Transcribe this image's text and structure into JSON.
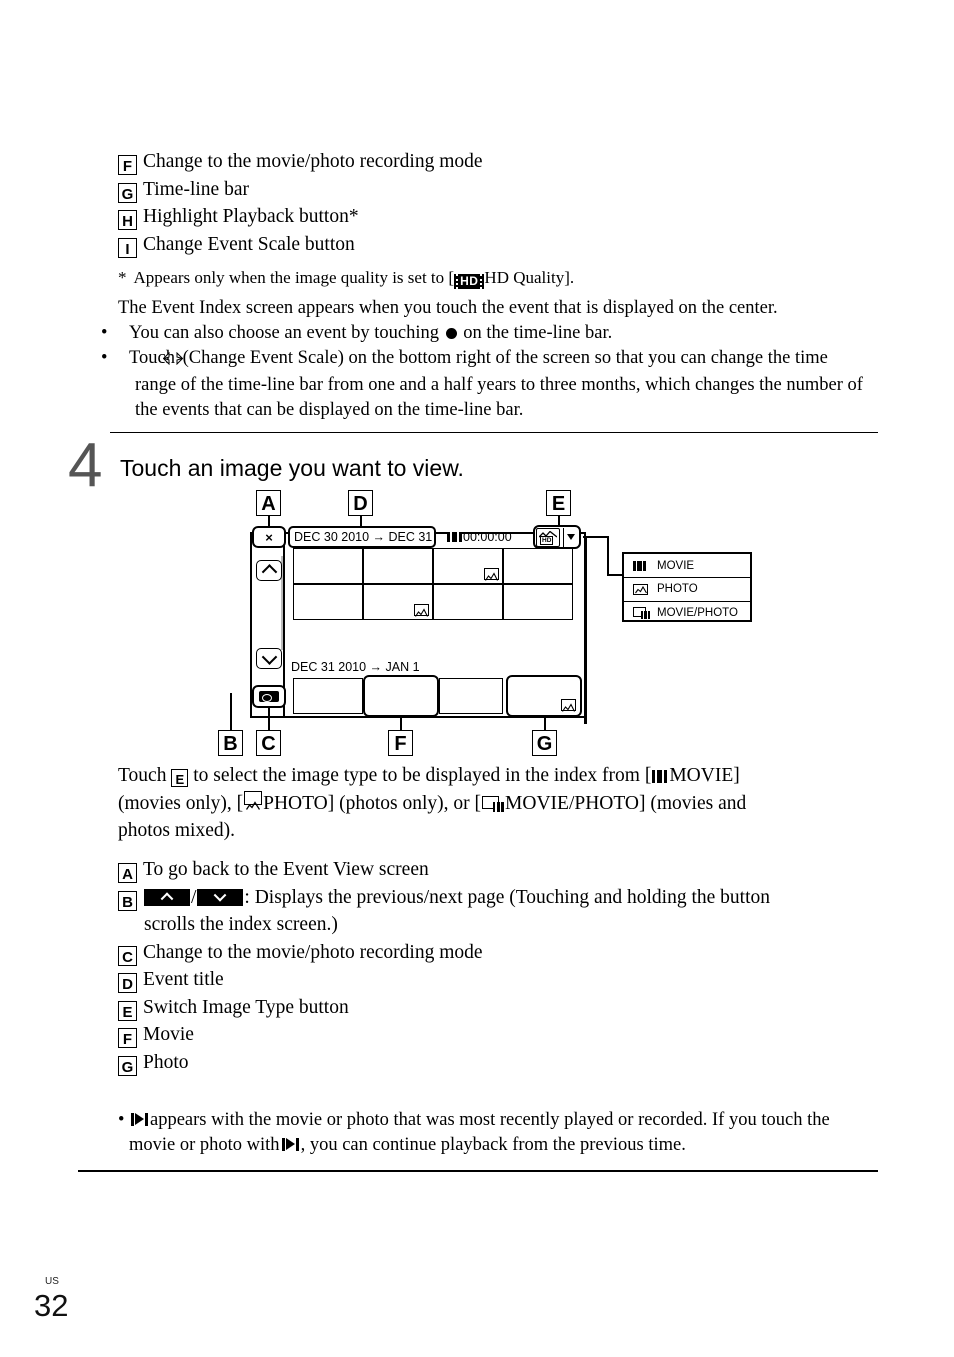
{
  "top_reference": {
    "items": [
      {
        "letter": "F",
        "text": "Change to the movie/photo recording mode"
      },
      {
        "letter": "G",
        "text": "Time-line bar"
      },
      {
        "letter": "H",
        "text": "Highlight Playback button*"
      },
      {
        "letter": "I",
        "text": "Change Event Scale button"
      }
    ]
  },
  "footnote": {
    "marker": "*",
    "before": "Appears only when the image quality is set to [",
    "badge": "HD",
    "after": "HD Quality]."
  },
  "intro": {
    "line1": "The Event Index screen appears when you touch the event that is displayed on the center.",
    "bullet1_before": "You can also choose an event by touching",
    "bullet1_after": "on the time-line bar.",
    "bullet2_line1_before": "Touch",
    "bullet2_line1_after": "(Change Event Scale) on the bottom right of the screen so that you can change the time",
    "bullet2_line2": "range of the time-line bar from one and a half years to three months, which changes the number of",
    "bullet2_line3": "the events that can be displayed on the time-line bar."
  },
  "step": {
    "number": "4",
    "title": "Touch an image you want to view."
  },
  "diagram": {
    "callouts": {
      "a": "A",
      "b": "B",
      "c": "C",
      "d": "D",
      "e": "E",
      "f": "F",
      "g": "G"
    },
    "screen": {
      "close_button": "×",
      "event_title": "DEC 30 2010 → DEC 31",
      "timecode": "00:00:00",
      "second_section_title": "DEC 31 2010 → JAN 1",
      "switch_button_quality": "HD"
    },
    "menu": {
      "items": [
        {
          "icon": "movie-icon",
          "label": "MOVIE"
        },
        {
          "icon": "photo-icon",
          "label": "PHOTO"
        },
        {
          "icon": "movie-photo-icon",
          "label": "MOVIE/PHOTO"
        }
      ]
    }
  },
  "touch_paragraph": {
    "p1": "Touch",
    "p2": "to select the image type to be displayed in the index from [",
    "movie_label": "MOVIE]",
    "p3": "(movies only), [",
    "photo_label": "PHOTO] (photos only), or [",
    "both_label": "MOVIE/PHOTO] (movies and",
    "p4": "photos mixed)."
  },
  "ag_reference": {
    "items": [
      {
        "letter": "A",
        "text": "To go back to the Event View screen"
      },
      {
        "letter": "B",
        "text": ": Displays the previous/next page (Touching and holding the button",
        "cont": "scrolls the index screen.)",
        "has_buttons": true,
        "separator": "/"
      },
      {
        "letter": "C",
        "text": "Change to the movie/photo recording mode"
      },
      {
        "letter": "D",
        "text": "Event title"
      },
      {
        "letter": "E",
        "text": "Switch Image Type button"
      },
      {
        "letter": "F",
        "text": "Movie"
      },
      {
        "letter": "G",
        "text": "Photo"
      }
    ]
  },
  "last_bullet": {
    "part1": "appears with the movie or photo that was most recently played or recorded. If you touch the",
    "part2": "movie or photo with",
    "part3": ", you can continue playback from the previous time."
  },
  "footer": {
    "region": "US",
    "page": "32"
  }
}
